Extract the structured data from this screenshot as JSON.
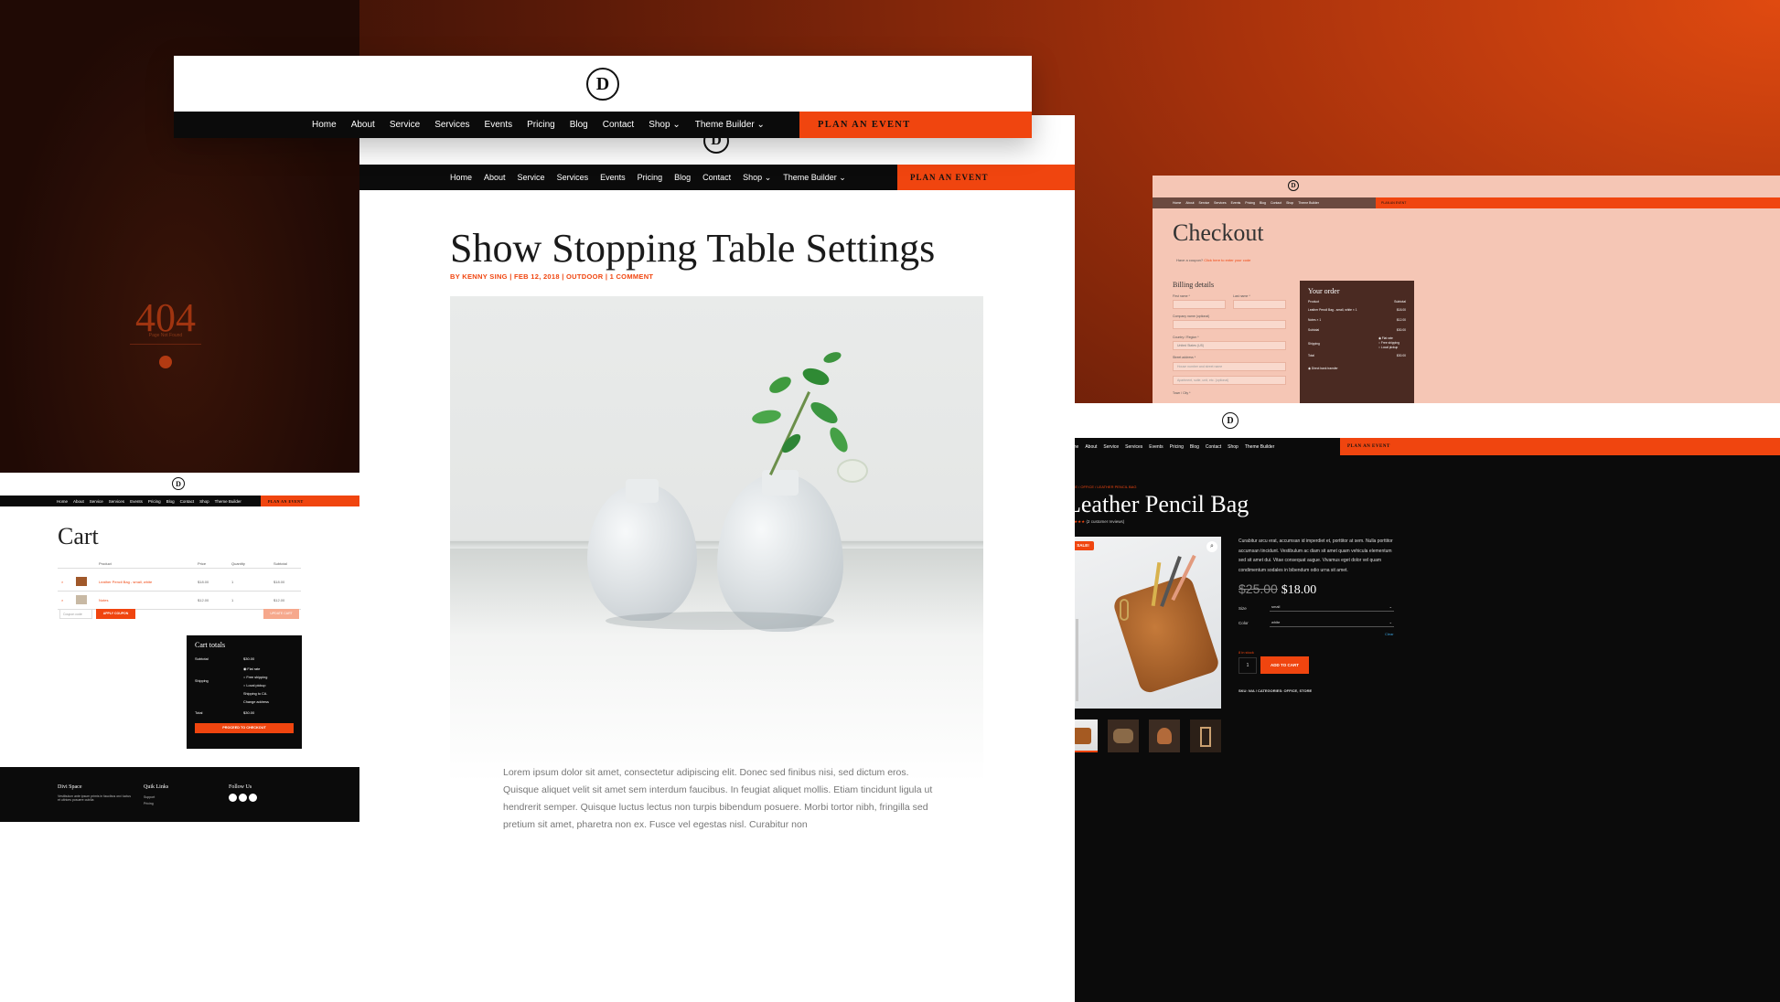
{
  "brand": {
    "logo_letter": "D",
    "accent": "#f0450f",
    "dark": "#0b0b0b"
  },
  "nav": {
    "items": [
      "Home",
      "About",
      "Service",
      "Services",
      "Events",
      "Pricing",
      "Blog",
      "Contact",
      "Shop",
      "Theme Builder"
    ],
    "cta": "PLAN AN EVENT",
    "dropdown_glyph": "⌄"
  },
  "blog": {
    "title": "Show Stopping Table Settings",
    "meta": "BY KENNY SING | FEB 12, 2018 | OUTDOOR | 1 COMMENT",
    "body": "Lorem ipsum dolor sit amet, consectetur adipiscing elit. Donec sed finibus nisi, sed dictum eros. Quisque aliquet velit sit amet sem interdum faucibus. In feugiat aliquet mollis. Etiam tincidunt ligula ut hendrerit semper. Quisque luctus lectus non turpis bibendum posuere. Morbi tortor nibh, fringilla sed pretium sit amet, pharetra non ex. Fusce vel egestas nisl. Curabitur non"
  },
  "notfound": {
    "code": "404",
    "sub": "Page Not Found"
  },
  "cart": {
    "title": "Cart",
    "headers": [
      "Product",
      "Price",
      "Quantity",
      "Subtotal"
    ],
    "rows": [
      {
        "name": "Leather Pencil Bag - small, white",
        "price": "$18.00",
        "qty": "1",
        "subtotal": "$18.00"
      },
      {
        "name": "Notes",
        "price": "$12.00",
        "qty": "1",
        "subtotal": "$12.00"
      }
    ],
    "coupon_placeholder": "Coupon code",
    "apply": "APPLY COUPON",
    "update": "UPDATE CART",
    "totals_title": "Cart totals",
    "subtotal_label": "Subtotal",
    "subtotal": "$30.00",
    "shipping_label": "Shipping",
    "shipping_opts": [
      "Flat rate",
      "Free shipping",
      "Local pickup"
    ],
    "shipping_to": "Shipping to CA.",
    "change_address": "Change address",
    "total_label": "Total",
    "total": "$30.00",
    "checkout_btn": "PROCEED TO CHECKOUT"
  },
  "footer": {
    "col1": "Divi Space",
    "col1_text": "Vestibulum ante ipsum primis in faucibus orci luctus et ultrices posuere cubilia",
    "col2": "Quik Links",
    "col2_items": [
      "Support",
      "Pricing"
    ],
    "col3": "Follow Us"
  },
  "checkout": {
    "title": "Checkout",
    "coupon": "Have a coupon?",
    "coupon_link": "Click here to enter your code",
    "billing": "Billing details",
    "first": "First name *",
    "last": "Last name *",
    "company": "Company name (optional)",
    "country": "Country / Region *",
    "country_val": "United States (US)",
    "street": "Street address *",
    "street_ph": "House number and street name",
    "apt_ph": "Apartment, suite, unit, etc. (optional)",
    "town": "Town / City *",
    "order_title": "Your order",
    "order_head": [
      "Product",
      "Subtotal"
    ],
    "order_rows": [
      [
        "Leather Pencil Bag - small, white × 1",
        "$18.00"
      ],
      [
        "Notes × 1",
        "$12.00"
      ],
      [
        "Subtotal",
        "$30.00"
      ],
      [
        "Shipping",
        ""
      ],
      [
        "Total",
        "$30.00"
      ]
    ],
    "ship_opts": [
      "Flat rate",
      "Free shipping",
      "Local pickup"
    ],
    "payment": "Direct bank transfer"
  },
  "product": {
    "breadcrumb": "HOME / OFFICE / LEATHER PENCIL BAG",
    "title": "Leather Pencil Bag",
    "stars": "★★★★★",
    "reviews": "(2 customer reviews)",
    "sale": "SALE!",
    "old_price": "$25.00",
    "price": "$18.00",
    "desc": "Curabitur arcu erat, accumsan id imperdiet et, porttitor at sem. Nulla porttitor accumsan tincidunt. Vestibulum ac diam sit amet quam vehicula elementum sed sit amet dui. Vitae consequat augue. Vivamus eget dolor vel quam condimentum sodales in bibendum odio urna sit amet.",
    "size_label": "Size",
    "size_val": "small",
    "color_label": "Color",
    "color_val": "white",
    "clear": "Clear",
    "stock": "8 in stock",
    "qty": "1",
    "add": "ADD TO CART",
    "sku": "SKU: N/A / CATEGORIES: OFFICE, STORE"
  }
}
